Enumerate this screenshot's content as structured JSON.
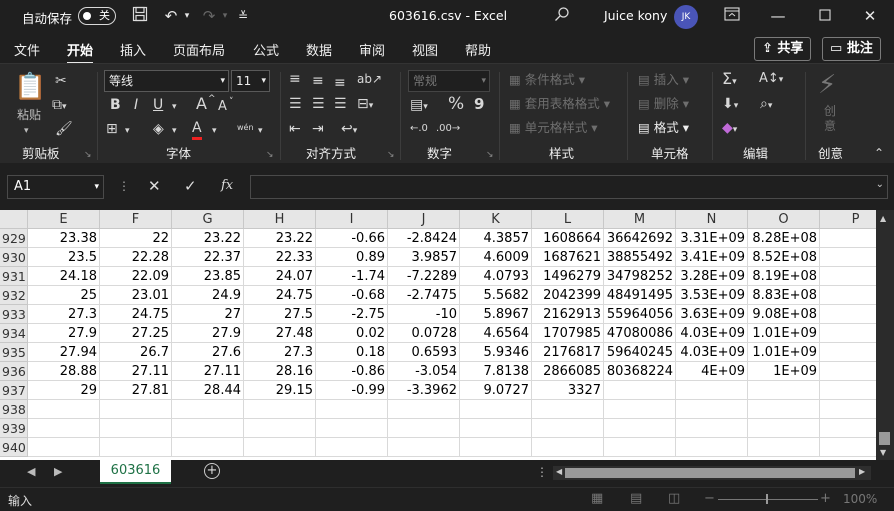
{
  "titlebar": {
    "autosave": "自动保存",
    "autosave_state": "关",
    "title": "603616.csv  -  Excel",
    "user": "Juice kony",
    "initials": "JK"
  },
  "menu": [
    "文件",
    "开始",
    "插入",
    "页面布局",
    "公式",
    "数据",
    "审阅",
    "视图",
    "帮助"
  ],
  "share": "共享",
  "comment": "批注",
  "ribbon": {
    "clipboard": {
      "label": "剪贴板",
      "paste": "粘贴"
    },
    "font": {
      "label": "字体",
      "name": "等线",
      "size": "11",
      "bold": "B",
      "italic": "I",
      "underline": "U",
      "grow": "A",
      "shrink": "A",
      "font_color": "A",
      "phonetic": "wén"
    },
    "align": {
      "label": "对齐方式"
    },
    "number": {
      "label": "数字",
      "format": "常规",
      "percent": "%",
      "comma": "9"
    },
    "styles": {
      "label": "样式",
      "cond": "条件格式",
      "table": "套用表格格式",
      "cell": "单元格样式"
    },
    "cells": {
      "label": "单元格",
      "insert": "插入",
      "delete": "删除",
      "format": "格式"
    },
    "edit": {
      "label": "编辑"
    },
    "ai": {
      "label": "创意",
      "btn": "创\n意"
    }
  },
  "formula": {
    "namebox": "A1",
    "fx": "fx",
    "value": ""
  },
  "columns": [
    "E",
    "F",
    "G",
    "H",
    "I",
    "J",
    "K",
    "L",
    "M",
    "N",
    "O",
    "P"
  ],
  "rows": [
    {
      "n": "929",
      "c": [
        "23.38",
        "22",
        "23.22",
        "23.22",
        "-0.66",
        "-2.8424",
        "4.3857",
        "1608664",
        "36642692",
        "3.31E+09",
        "8.28E+08",
        ""
      ]
    },
    {
      "n": "930",
      "c": [
        "23.5",
        "22.28",
        "22.37",
        "22.33",
        "0.89",
        "3.9857",
        "4.6009",
        "1687621",
        "38855492",
        "3.41E+09",
        "8.52E+08",
        ""
      ]
    },
    {
      "n": "931",
      "c": [
        "24.18",
        "22.09",
        "23.85",
        "24.07",
        "-1.74",
        "-7.2289",
        "4.0793",
        "1496279",
        "34798252",
        "3.28E+09",
        "8.19E+08",
        ""
      ]
    },
    {
      "n": "932",
      "c": [
        "25",
        "23.01",
        "24.9",
        "24.75",
        "-0.68",
        "-2.7475",
        "5.5682",
        "2042399",
        "48491495",
        "3.53E+09",
        "8.83E+08",
        ""
      ]
    },
    {
      "n": "933",
      "c": [
        "27.3",
        "24.75",
        "27",
        "27.5",
        "-2.75",
        "-10",
        "5.8967",
        "2162913",
        "55964056",
        "3.63E+09",
        "9.08E+08",
        ""
      ]
    },
    {
      "n": "934",
      "c": [
        "27.9",
        "27.25",
        "27.9",
        "27.48",
        "0.02",
        "0.0728",
        "4.6564",
        "1707985",
        "47080086",
        "4.03E+09",
        "1.01E+09",
        ""
      ]
    },
    {
      "n": "935",
      "c": [
        "27.94",
        "26.7",
        "27.6",
        "27.3",
        "0.18",
        "0.6593",
        "5.9346",
        "2176817",
        "59640245",
        "4.03E+09",
        "1.01E+09",
        ""
      ]
    },
    {
      "n": "936",
      "c": [
        "28.88",
        "27.11",
        "27.11",
        "28.16",
        "-0.86",
        "-3.054",
        "7.8138",
        "2866085",
        "80368224",
        "4E+09",
        "1E+09",
        ""
      ]
    },
    {
      "n": "937",
      "c": [
        "29",
        "27.81",
        "28.44",
        "29.15",
        "-0.99",
        "-3.3962",
        "9.0727",
        "3327",
        "",
        "",
        "",
        ""
      ]
    },
    {
      "n": "938",
      "c": [
        "",
        "",
        "",
        "",
        "",
        "",
        "",
        "",
        "",
        "",
        "",
        ""
      ]
    },
    {
      "n": "939",
      "c": [
        "",
        "",
        "",
        "",
        "",
        "",
        "",
        "",
        "",
        "",
        "",
        ""
      ]
    },
    {
      "n": "940",
      "c": [
        "",
        "",
        "",
        "",
        "",
        "",
        "",
        "",
        "",
        "",
        "",
        ""
      ]
    }
  ],
  "sheet": "603616",
  "status": {
    "mode": "输入",
    "zoom": "100%"
  }
}
